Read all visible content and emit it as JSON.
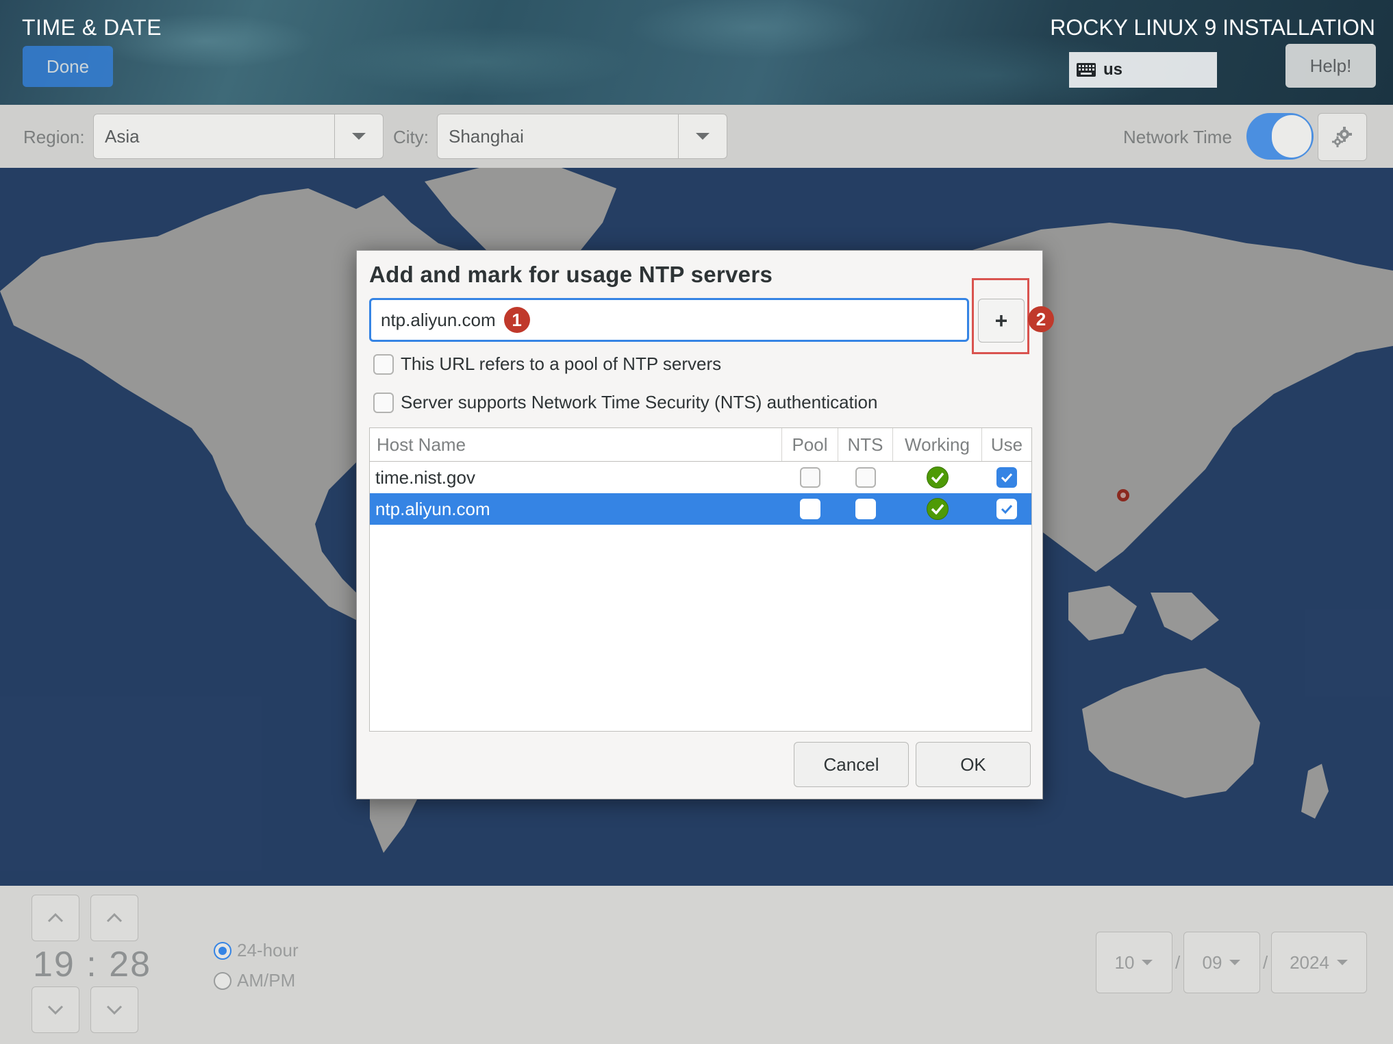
{
  "header": {
    "title": "TIME & DATE",
    "done_label": "Done",
    "install_title": "ROCKY LINUX 9 INSTALLATION",
    "keyboard_layout": "us",
    "help_label": "Help!"
  },
  "toolbar": {
    "region_label": "Region:",
    "region_value": "Asia",
    "city_label": "City:",
    "city_value": "Shanghai",
    "network_time_label": "Network Time",
    "network_time_on": true
  },
  "dialog": {
    "title": "Add and mark for usage NTP servers",
    "input_value": "ntp.aliyun.com",
    "marker1": "1",
    "marker2": "2",
    "add_label": "+",
    "pool_checkbox_label": "This URL refers to a pool of NTP servers",
    "nts_checkbox_label": "Server supports Network Time Security (NTS) authentication",
    "columns": [
      "Host Name",
      "Pool",
      "NTS",
      "Working",
      "Use"
    ],
    "rows": [
      {
        "host": "time.nist.gov",
        "pool": false,
        "nts": false,
        "working": true,
        "use": true,
        "selected": false
      },
      {
        "host": "ntp.aliyun.com",
        "pool": false,
        "nts": false,
        "working": true,
        "use": true,
        "selected": true
      }
    ],
    "cancel_label": "Cancel",
    "ok_label": "OK"
  },
  "time": {
    "hours": "19",
    "separator": ":",
    "minutes": "28",
    "format_24": "24-hour",
    "format_ampm": "AM/PM",
    "selected_format": "24-hour"
  },
  "date": {
    "month": "10",
    "day": "09",
    "year": "2024",
    "separator": "/"
  },
  "colors": {
    "accent": "#3584e4",
    "marker": "#c0392b",
    "highlight": "#d9534f",
    "working_ok": "#4e9a06",
    "map_ocean": "#34578a"
  },
  "icons": {
    "keyboard": "keyboard-icon",
    "gear": "gear-icon",
    "dropdown": "chevron-down-icon",
    "spin_up": "chevron-up-icon",
    "spin_down": "chevron-down-icon",
    "working": "checkmark-circle-icon",
    "location": "location-pin-icon"
  }
}
